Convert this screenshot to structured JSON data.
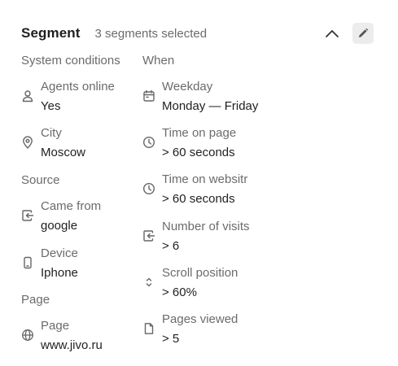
{
  "header": {
    "title": "Segment",
    "subtitle": "3 segments selected"
  },
  "left_column": {
    "system_conditions": {
      "heading": "System conditions",
      "items": [
        {
          "label": "Agents online",
          "value": "Yes",
          "icon": "person-icon"
        },
        {
          "label": "City",
          "value": "Moscow",
          "icon": "location-pin-icon"
        }
      ]
    },
    "source": {
      "heading": "Source",
      "items": [
        {
          "label": "Came from",
          "value": "google",
          "icon": "login-arrow-icon"
        },
        {
          "label": "Device",
          "value": "Iphone",
          "icon": "smartphone-icon"
        }
      ]
    },
    "page": {
      "heading": "Page",
      "items": [
        {
          "label": "Page",
          "value": "www.jivo.ru",
          "icon": "globe-icon"
        }
      ]
    }
  },
  "right_column": {
    "when": {
      "heading": "When",
      "items": [
        {
          "label": "Weekday",
          "value": "Monday — Friday",
          "icon": "calendar-icon"
        },
        {
          "label": "Time on page",
          "value": "> 60 seconds",
          "icon": "clock-icon"
        },
        {
          "label": "Time on websitr",
          "value": "> 60 seconds",
          "icon": "clock-icon"
        },
        {
          "label": "Number of visits",
          "value": "> 6",
          "icon": "login-arrow-icon"
        },
        {
          "label": "Scroll position",
          "value": "> 60%",
          "icon": "scroll-updown-icon"
        },
        {
          "label": "Pages viewed",
          "value": "> 5",
          "icon": "document-icon"
        }
      ]
    }
  },
  "colors": {
    "text_primary": "#1f1f1f",
    "text_secondary": "#6b6b6b",
    "icon": "#6b6b6b",
    "edit_button_bg": "#ececec"
  }
}
